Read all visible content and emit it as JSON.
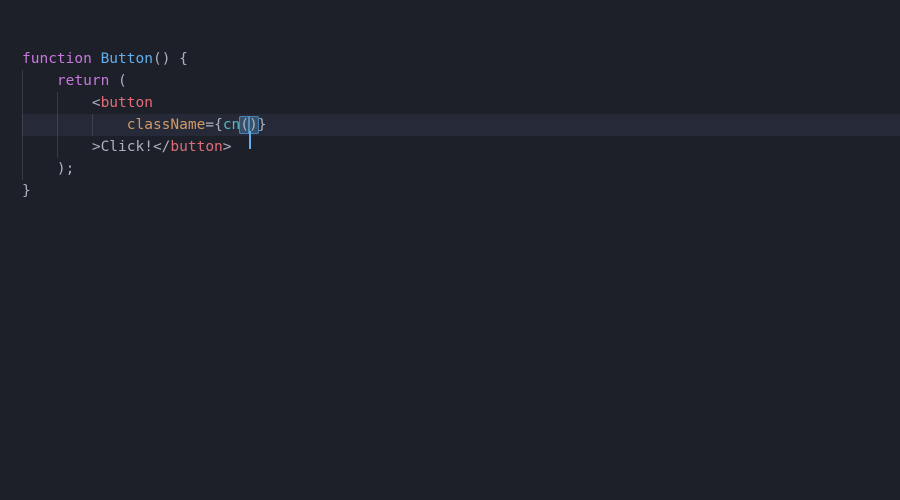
{
  "editor": {
    "language": "javascript-jsx",
    "theme_bg": "#1e2029",
    "active_line_index": 3,
    "lines": [
      {
        "indent_guides": 0,
        "segments": [
          {
            "t": "function",
            "cls": "kw"
          },
          {
            "t": " ",
            "cls": "punct"
          },
          {
            "t": "Button",
            "cls": "fn"
          },
          {
            "t": "()",
            "cls": "punct"
          },
          {
            "t": " {",
            "cls": "punct"
          }
        ]
      },
      {
        "indent_guides": 1,
        "segments": [
          {
            "t": "    ",
            "cls": "punct"
          },
          {
            "t": "return",
            "cls": "kw"
          },
          {
            "t": " (",
            "cls": "punct"
          }
        ]
      },
      {
        "indent_guides": 2,
        "segments": [
          {
            "t": "        <",
            "cls": "punct"
          },
          {
            "t": "button",
            "cls": "tag"
          }
        ]
      },
      {
        "indent_guides": 3,
        "segments": [
          {
            "t": "            ",
            "cls": "punct"
          },
          {
            "t": "className",
            "cls": "attr"
          },
          {
            "t": "={",
            "cls": "punct"
          },
          {
            "t": "cn",
            "cls": "call"
          },
          {
            "t": "(",
            "cls": "punct",
            "match": true
          },
          {
            "t": "",
            "cls": "punct",
            "cursor": true
          },
          {
            "t": ")",
            "cls": "punct",
            "match": true
          },
          {
            "t": "}",
            "cls": "punct"
          }
        ]
      },
      {
        "indent_guides": 2,
        "segments": [
          {
            "t": "        >Click!</",
            "cls": "punct"
          },
          {
            "t": "button",
            "cls": "tag"
          },
          {
            "t": ">",
            "cls": "punct"
          }
        ]
      },
      {
        "indent_guides": 1,
        "segments": [
          {
            "t": "    );",
            "cls": "punct"
          }
        ]
      },
      {
        "indent_guides": 0,
        "segments": [
          {
            "t": "}",
            "cls": "punct"
          }
        ]
      }
    ]
  }
}
